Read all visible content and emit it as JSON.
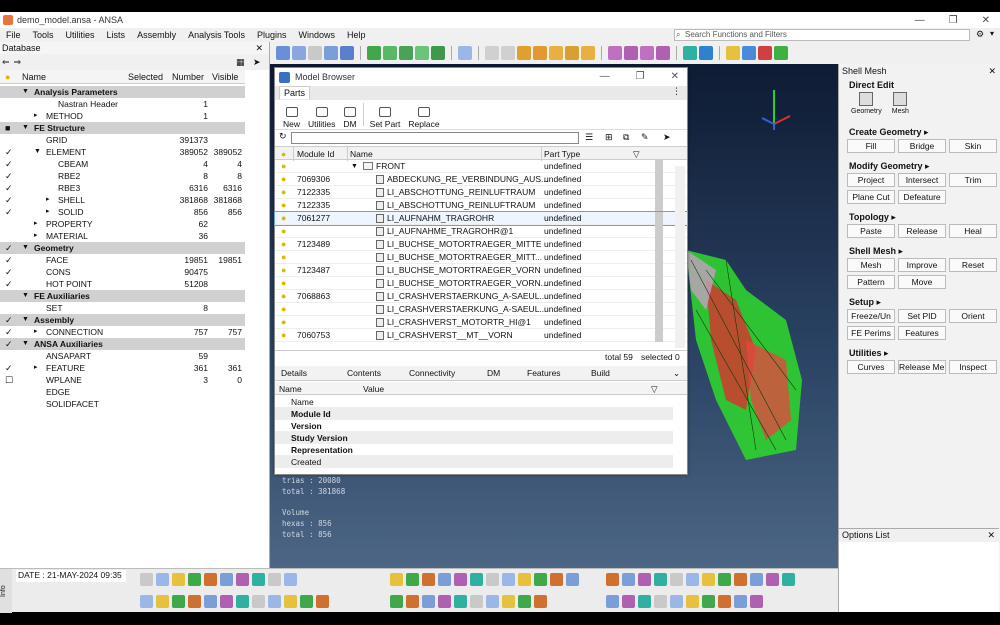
{
  "window": {
    "title": "demo_model.ansa - ANSA",
    "controls": [
      "—",
      "❐",
      "✕"
    ]
  },
  "menu": [
    "File",
    "Tools",
    "Utilities",
    "Lists",
    "Assembly",
    "Analysis Tools",
    "Plugins",
    "Windows",
    "Help"
  ],
  "search": {
    "placeholder": "Search Functions and Filters"
  },
  "database": {
    "title": "Database",
    "columns": {
      "name": "Name",
      "selected": "Selected",
      "number": "Number",
      "visible": "Visible"
    },
    "rows": [
      {
        "label": "Analysis Parameters",
        "section": true,
        "checked": false,
        "arrow": "▼",
        "indent": 0,
        "number": "",
        "visible": ""
      },
      {
        "label": "Nastran Header",
        "section": false,
        "checked": false,
        "arrow": "",
        "indent": 2,
        "number": "1",
        "visible": ""
      },
      {
        "label": "METHOD",
        "section": false,
        "checked": false,
        "arrow": "▸",
        "indent": 1,
        "number": "1",
        "visible": ""
      },
      {
        "label": "FE Structure",
        "section": true,
        "checked": "partial",
        "arrow": "▼",
        "indent": 0,
        "number": "",
        "visible": ""
      },
      {
        "label": "GRID",
        "section": false,
        "checked": false,
        "arrow": "",
        "indent": 1,
        "number": "391373",
        "visible": ""
      },
      {
        "label": "ELEMENT",
        "section": false,
        "checked": true,
        "arrow": "▼",
        "indent": 1,
        "number": "389052",
        "visible": "389052"
      },
      {
        "label": "CBEAM",
        "section": false,
        "checked": true,
        "arrow": "",
        "indent": 2,
        "number": "4",
        "visible": "4"
      },
      {
        "label": "RBE2",
        "section": false,
        "checked": true,
        "arrow": "",
        "indent": 2,
        "number": "8",
        "visible": "8"
      },
      {
        "label": "RBE3",
        "section": false,
        "checked": true,
        "arrow": "",
        "indent": 2,
        "number": "6316",
        "visible": "6316"
      },
      {
        "label": "SHELL",
        "section": false,
        "checked": true,
        "arrow": "▸",
        "indent": 2,
        "number": "381868",
        "visible": "381868"
      },
      {
        "label": "SOLID",
        "section": false,
        "checked": true,
        "arrow": "▸",
        "indent": 2,
        "number": "856",
        "visible": "856"
      },
      {
        "label": "PROPERTY",
        "section": false,
        "checked": false,
        "arrow": "▸",
        "indent": 1,
        "number": "62",
        "visible": ""
      },
      {
        "label": "MATERIAL",
        "section": false,
        "checked": false,
        "arrow": "▸",
        "indent": 1,
        "number": "36",
        "visible": ""
      },
      {
        "label": "Geometry",
        "section": true,
        "checked": true,
        "arrow": "▼",
        "indent": 0,
        "number": "",
        "visible": ""
      },
      {
        "label": "FACE",
        "section": false,
        "checked": true,
        "arrow": "",
        "indent": 1,
        "number": "19851",
        "visible": "19851"
      },
      {
        "label": "CONS",
        "section": false,
        "checked": true,
        "arrow": "",
        "indent": 1,
        "number": "90475",
        "visible": ""
      },
      {
        "label": "HOT POINT",
        "section": false,
        "checked": true,
        "arrow": "",
        "indent": 1,
        "number": "51208",
        "visible": ""
      },
      {
        "label": "FE Auxiliaries",
        "section": true,
        "checked": false,
        "arrow": "▼",
        "indent": 0,
        "number": "",
        "visible": ""
      },
      {
        "label": "SET",
        "section": false,
        "checked": false,
        "arrow": "",
        "indent": 1,
        "number": "8",
        "visible": ""
      },
      {
        "label": "Assembly",
        "section": true,
        "checked": true,
        "arrow": "▼",
        "indent": 0,
        "number": "",
        "visible": ""
      },
      {
        "label": "CONNECTION",
        "section": false,
        "checked": true,
        "arrow": "▸",
        "indent": 1,
        "number": "757",
        "visible": "757"
      },
      {
        "label": "ANSA Auxiliaries",
        "section": true,
        "checked": true,
        "arrow": "▼",
        "indent": 0,
        "number": "",
        "visible": ""
      },
      {
        "label": "ANSAPART",
        "section": false,
        "checked": false,
        "arrow": "",
        "indent": 1,
        "number": "59",
        "visible": ""
      },
      {
        "label": "FEATURE",
        "section": false,
        "checked": true,
        "arrow": "▸",
        "indent": 1,
        "number": "361",
        "visible": "361"
      },
      {
        "label": "WPLANE",
        "section": false,
        "checked": "box",
        "arrow": "",
        "indent": 1,
        "number": "3",
        "visible": "0"
      },
      {
        "label": "EDGE",
        "section": false,
        "checked": false,
        "arrow": "",
        "indent": 1,
        "number": "",
        "visible": ""
      },
      {
        "label": "SOLIDFACET",
        "section": false,
        "checked": false,
        "arrow": "",
        "indent": 1,
        "number": "",
        "visible": ""
      }
    ]
  },
  "model_browser": {
    "title": "Model Browser",
    "tab": "Parts",
    "ribbon": [
      "New",
      "Utilities",
      "DM",
      "Set Part",
      "Replace"
    ],
    "columns": {
      "module_id": "Module Id",
      "name": "Name",
      "part_type": "Part Type"
    },
    "rows": [
      {
        "module_id": "",
        "name": "FRONT",
        "part_type": "undefined",
        "folder": true,
        "selected": false
      },
      {
        "module_id": "7069306",
        "name": "ABDECKUNG_RE_VERBINDUNG_AUS...",
        "part_type": "undefined",
        "folder": false,
        "selected": false
      },
      {
        "module_id": "7122335",
        "name": "LI_ABSCHOTTUNG_REINLUFTRAUM",
        "part_type": "undefined",
        "folder": false,
        "selected": false
      },
      {
        "module_id": "7122335",
        "name": "LI_ABSCHOTTUNG_REINLUFTRAUM",
        "part_type": "undefined",
        "folder": false,
        "selected": false
      },
      {
        "module_id": "7061277",
        "name": "LI_AUFNAHM_TRAGROHR",
        "part_type": "undefined",
        "folder": false,
        "selected": true
      },
      {
        "module_id": "",
        "name": "LI_AUFNAHME_TRAGROHR@1",
        "part_type": "undefined",
        "folder": false,
        "selected": false
      },
      {
        "module_id": "7123489",
        "name": "LI_BUCHSE_MOTORTRAEGER_MITTE",
        "part_type": "undefined",
        "folder": false,
        "selected": false
      },
      {
        "module_id": "",
        "name": "LI_BUCHSE_MOTORTRAEGER_MITT...",
        "part_type": "undefined",
        "folder": false,
        "selected": false
      },
      {
        "module_id": "7123487",
        "name": "LI_BUCHSE_MOTORTRAEGER_VORN",
        "part_type": "undefined",
        "folder": false,
        "selected": false
      },
      {
        "module_id": "",
        "name": "LI_BUCHSE_MOTORTRAEGER_VORN...",
        "part_type": "undefined",
        "folder": false,
        "selected": false
      },
      {
        "module_id": "7068863",
        "name": "LI_CRASHVERSTAERKUNG_A-SAEUL...",
        "part_type": "undefined",
        "folder": false,
        "selected": false
      },
      {
        "module_id": "",
        "name": "LI_CRASHVERSTAERKUNG_A-SAEUL...",
        "part_type": "undefined",
        "folder": false,
        "selected": false
      },
      {
        "module_id": "",
        "name": "LI_CRASHVERST_MOTORTR_HI@1",
        "part_type": "undefined",
        "folder": false,
        "selected": false
      },
      {
        "module_id": "7060753",
        "name": "LI_CRASHVERST__MT__VORN",
        "part_type": "undefined",
        "folder": false,
        "selected": false
      }
    ],
    "status": {
      "total": "total 59",
      "selected": "selected 0"
    },
    "detail_tabs": [
      "Details",
      "Contents",
      "Connectivity",
      "DM",
      "Features",
      "Build"
    ],
    "detail_columns": {
      "name": "Name",
      "value": "Value"
    },
    "detail_rows": [
      {
        "label": "Name",
        "bold": false
      },
      {
        "label": "Module Id",
        "bold": true
      },
      {
        "label": "Version",
        "bold": true
      },
      {
        "label": "Study Version",
        "bold": true
      },
      {
        "label": "Representation",
        "bold": true
      },
      {
        "label": "Created",
        "bold": false
      }
    ]
  },
  "console": {
    "lines": [
      "trias  :   20080",
      "total  :  381868",
      "",
      "Volume",
      "hexas  :     856",
      "total  :     856"
    ]
  },
  "shell_mesh": {
    "title": "Shell Mesh",
    "sections": [
      {
        "title": "Direct Edit",
        "buttons": [],
        "icons": [
          "Geometry",
          "Mesh"
        ]
      },
      {
        "title": "Create Geometry ▸",
        "buttons": [
          "Fill",
          "Bridge",
          "Skin"
        ]
      },
      {
        "title": "Modify Geometry ▸",
        "buttons": [
          "Project",
          "Intersect",
          "Trim",
          "Plane Cut",
          "Defeature"
        ]
      },
      {
        "title": "Topology ▸",
        "buttons": [
          "Paste",
          "Release",
          "Heal"
        ]
      },
      {
        "title": "Shell Mesh ▸",
        "buttons": [
          "Mesh",
          "Improve",
          "Reset",
          "Pattern",
          "Move"
        ]
      },
      {
        "title": "Setup ▸",
        "buttons": [
          "Freeze/Un",
          "Set PID",
          "Orient",
          "FE Perims",
          "Features"
        ]
      },
      {
        "title": "Utilities ▸",
        "buttons": [
          "Curves",
          "Release Me.",
          "Inspect"
        ]
      }
    ],
    "options_title": "Options List"
  },
  "bottom": {
    "date": "DATE : 21-MAY-2024  09:35",
    "info": "Info"
  },
  "colors": {
    "accent": "#3a6fc4",
    "viewport_top": "#0e1b33",
    "mesh_green": "#2fd12f",
    "mesh_red": "#d13a2f"
  }
}
